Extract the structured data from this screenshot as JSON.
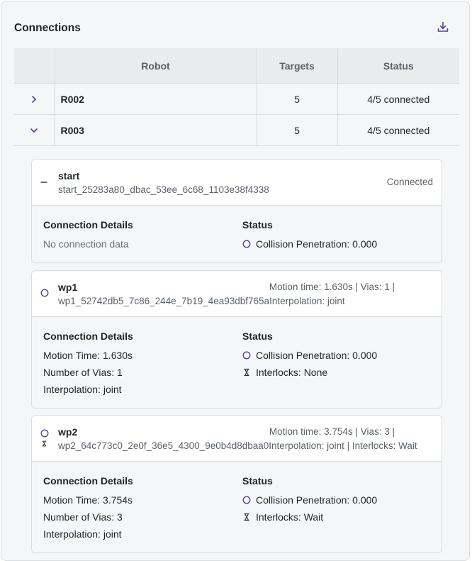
{
  "panel": {
    "title": "Connections",
    "download_icon": "download-icon"
  },
  "table": {
    "headers": [
      "",
      "Robot",
      "Targets",
      "Status"
    ],
    "rows": [
      {
        "expanded": false,
        "robot": "R002",
        "targets": "5",
        "status": "4/5 connected"
      },
      {
        "expanded": true,
        "robot": "R003",
        "targets": "5",
        "status": "4/5 connected"
      }
    ]
  },
  "cards": [
    {
      "name": "start",
      "id": "start_25283a80_dbac_53ee_6c68_1103e38f4338",
      "summary_right": "Connected",
      "summary_extra": "",
      "details_title": "Connection Details",
      "details": [
        "No connection data"
      ],
      "status_title": "Status",
      "status_lines": [
        {
          "icon": "circle-icon",
          "text": "Collision Penetration: 0.000"
        }
      ]
    },
    {
      "name": "wp1",
      "id": "wp1_52742db5_7c86_244e_7b19_4ea93dbf765a",
      "summary_right": "Motion time: 1.630s | Vias: 1 |",
      "summary_extra": "Interpolation: joint",
      "details_title": "Connection Details",
      "details": [
        "Motion Time: 1.630s",
        "Number of Vias: 1",
        "Interpolation: joint"
      ],
      "status_title": "Status",
      "status_lines": [
        {
          "icon": "circle-icon",
          "text": "Collision Penetration: 0.000"
        },
        {
          "icon": "hourglass-icon",
          "text": "Interlocks: None"
        }
      ]
    },
    {
      "name": "wp2",
      "id": "wp2_64c773c0_2e0f_36e5_4300_9e0b4d8dbaa0",
      "summary_right": "Motion time: 3.754s | Vias: 3 |",
      "summary_extra": "Interpolation: joint | Interlocks: Wait",
      "details_title": "Connection Details",
      "details": [
        "Motion Time: 3.754s",
        "Number of Vias: 3",
        "Interpolation: joint"
      ],
      "status_title": "Status",
      "status_lines": [
        {
          "icon": "circle-icon",
          "text": "Collision Penetration: 0.000"
        },
        {
          "icon": "hourglass-icon",
          "text": "Interlocks: Wait"
        }
      ]
    }
  ],
  "colors": {
    "accent": "#4b3f9e",
    "border": "#dadde1",
    "header_bg": "#e9ebed"
  }
}
